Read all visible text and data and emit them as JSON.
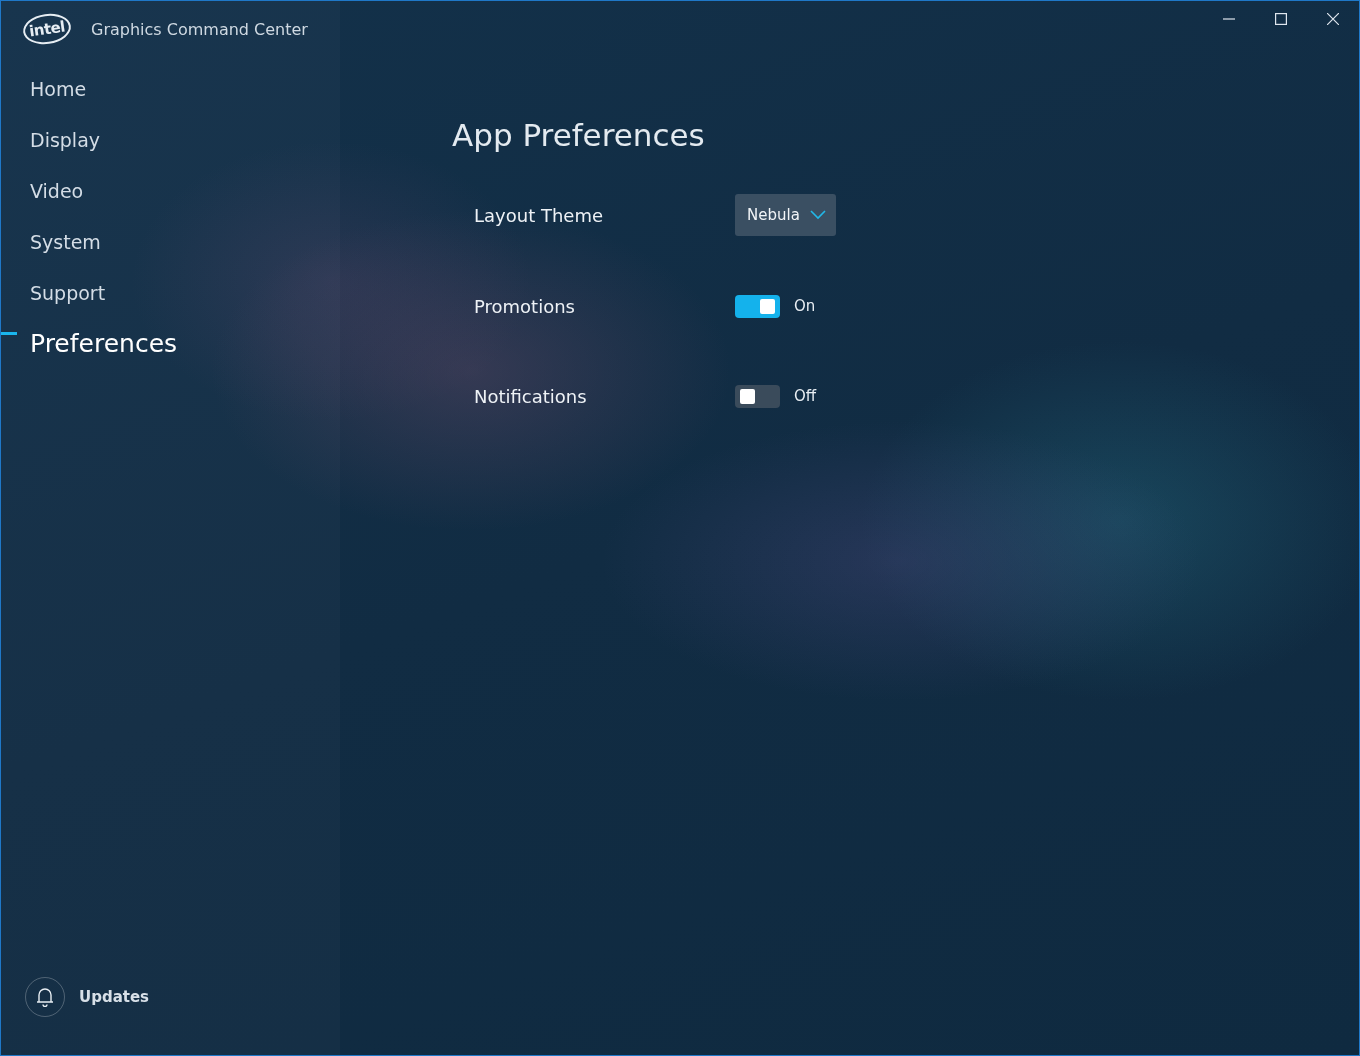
{
  "window": {
    "logo": "intel",
    "title": "Graphics Command Center"
  },
  "sidebar": {
    "items": [
      {
        "label": "Home",
        "selected": false
      },
      {
        "label": "Display",
        "selected": false
      },
      {
        "label": "Video",
        "selected": false
      },
      {
        "label": "System",
        "selected": false
      },
      {
        "label": "Support",
        "selected": false
      },
      {
        "label": "Preferences",
        "selected": true
      }
    ],
    "updates": "Updates"
  },
  "page": {
    "title": "App Preferences",
    "settings": [
      {
        "kind": "dropdown",
        "label": "Layout Theme",
        "value": "Nebula"
      },
      {
        "kind": "toggle",
        "label": "Promotions",
        "on": true,
        "state_text": "On"
      },
      {
        "kind": "toggle",
        "label": "Notifications",
        "on": false,
        "state_text": "Off"
      }
    ]
  }
}
